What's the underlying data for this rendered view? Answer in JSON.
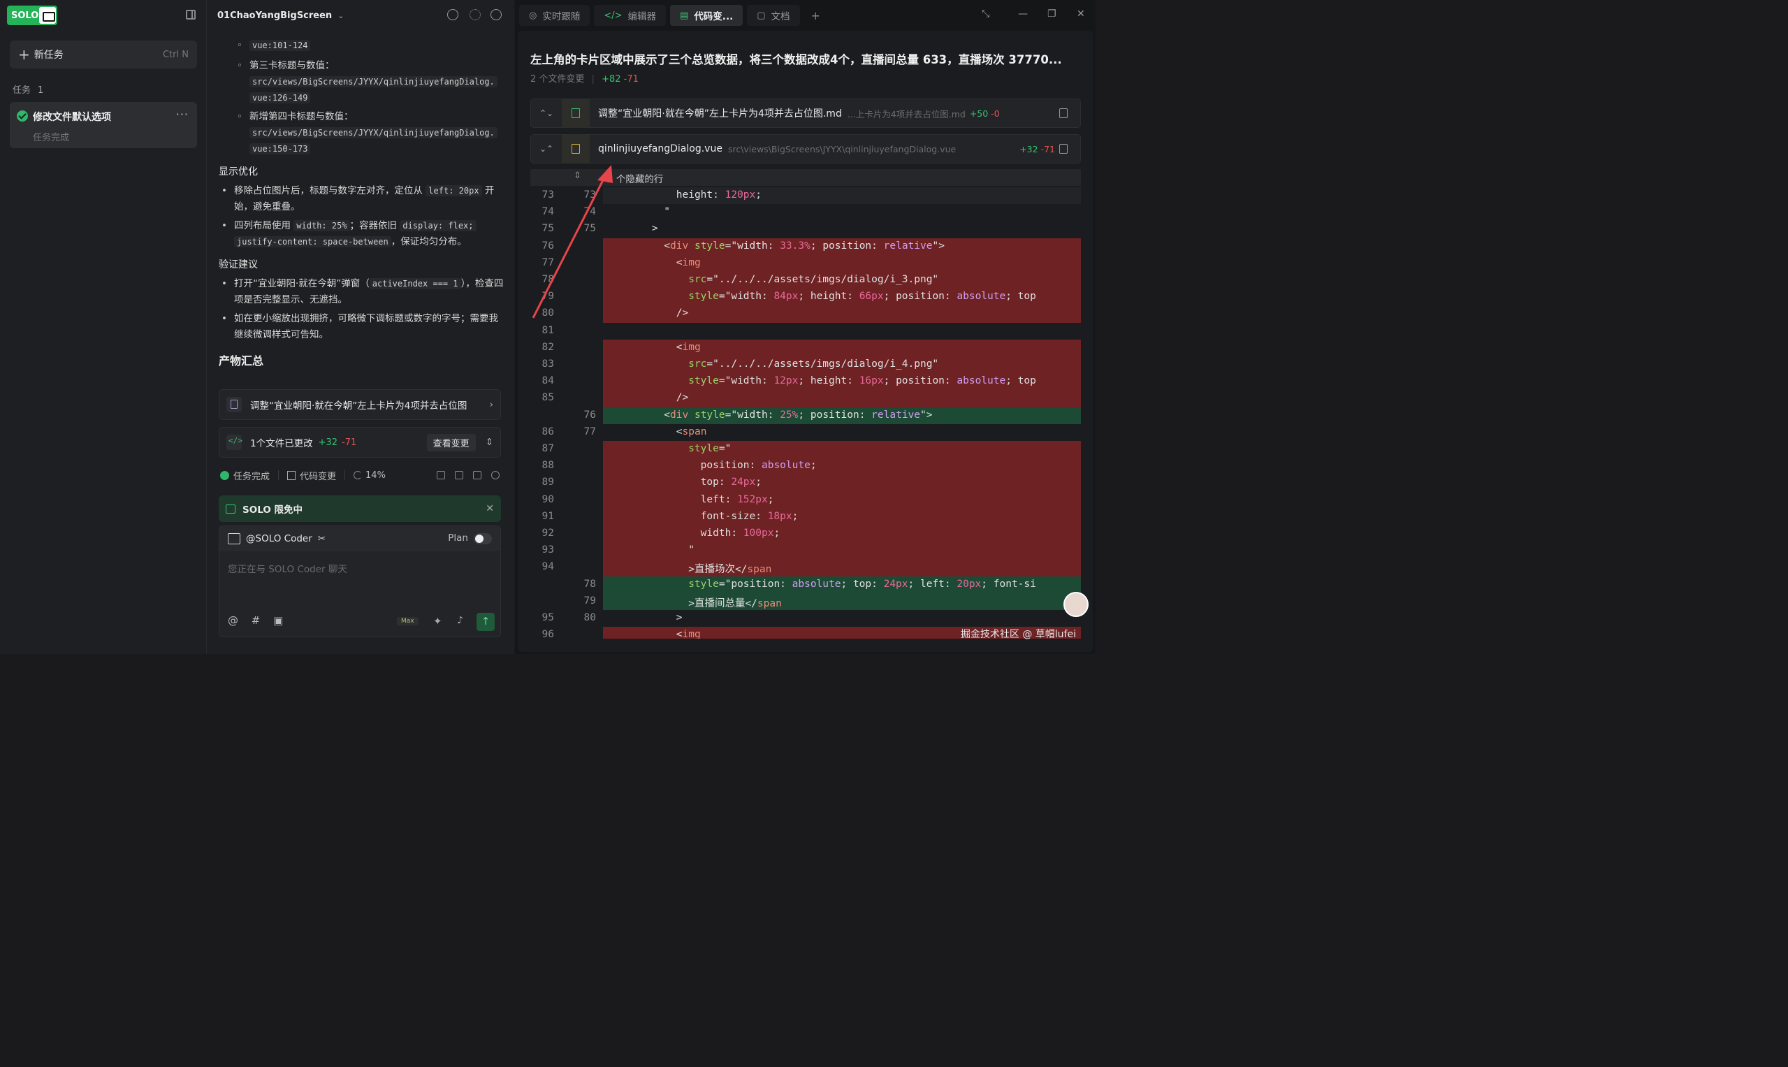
{
  "sidebar": {
    "logo_text": "SOLO",
    "new_task_label": "新任务",
    "new_task_shortcut": "Ctrl N",
    "tasks_header": "任务",
    "tasks_count": "1",
    "task": {
      "title": "修改文件默认选项",
      "status": "任务完成",
      "more": "···"
    }
  },
  "chat": {
    "project": "01ChaoYangBigScreen",
    "lines": {
      "l0": "vue:101-124",
      "l1_label": "第三卡标题与数值：",
      "l1_path": "src/views/BigScreens/JYYX/qinlinjiuyefangDialog.",
      "l1_range": "vue:126-149",
      "l2_label": "新增第四卡标题与数值：",
      "l2_path": "src/views/BigScreens/JYYX/qinlinjiuyefangDialog.",
      "l2_range": "vue:150-173"
    },
    "display_header": "显示优化",
    "d1_a": "移除占位图片后，标题与数字左对齐，定位从",
    "d1_code": "left: 20px",
    "d1_b": "开始，避免重叠。",
    "d2_a": "四列布局使用",
    "d2_code1": "width: 25%",
    "d2_b": "；容器依旧",
    "d2_code2": "display: flex;",
    "d2_code3": "justify-content: space-between",
    "d2_c": "，保证均匀分布。",
    "verify_header": "验证建议",
    "v1_a": "打开“宜业朝阳·就在今朝”弹窗（",
    "v1_code": "activeIndex === 1",
    "v1_b": "），检查四项是否完整显示、无遮挡。",
    "v2": "如在更小缩放出现拥挤，可略微下调标题或数字的字号；需要我继续微调样式可告知。",
    "artifacts_header": "产物汇总",
    "artifact_doc": "调整“宜业朝阳·就在今朝”左上卡片为4项并去占位图",
    "files_changed": "1个文件已更改",
    "files_add": "+32",
    "files_del": "-71",
    "view_changes": "查看变更",
    "status_done": "任务完成",
    "status_code": "代码变更",
    "status_pct": "14%",
    "promo": "SOLO 限免中",
    "agent": "@SOLO Coder",
    "plan_label": "Plan",
    "placeholder": "您正在与 SOLO Coder 聊天",
    "max_badge": "Max"
  },
  "tabs": [
    {
      "label": "实时跟随",
      "icon": "◎"
    },
    {
      "label": "编辑器",
      "icon": "</>"
    },
    {
      "label": "代码变...",
      "icon": "▤"
    },
    {
      "label": "文档",
      "icon": "▢"
    }
  ],
  "diffpane": {
    "title": "左上角的卡片区域中展示了三个总览数据，将三个数据改成4个，直播间总量 633，直播场次 37770...",
    "meta_files": "2 个文件变更",
    "meta_add": "+82",
    "meta_del": "-71",
    "file1": {
      "name": "调整“宜业朝阳·就在今朝”左上卡片为4项并去占位图.md",
      "path": "...上卡片为4项并去占位图.md",
      "add": "+50",
      "del": "-0"
    },
    "file2": {
      "name": "qinlinjiuyefangDialog.vue",
      "path": "src\\views\\BigScreens\\JYYX\\qinlinjiuyefangDialog.vue",
      "add": "+32",
      "del": "-71"
    },
    "hidden_rows": "2 个隐藏的行"
  },
  "diff_lines": [
    {
      "o": "73",
      "n": "73",
      "t": "ctx",
      "c": "            height: 120px;"
    },
    {
      "o": "74",
      "n": "74",
      "t": "ctx",
      "c": "          \""
    },
    {
      "o": "75",
      "n": "75",
      "t": "ctx",
      "c": "        >"
    },
    {
      "o": "76",
      "n": "",
      "t": "del",
      "c": "          <div style=\"width: 33.3%; position: relative\">"
    },
    {
      "o": "77",
      "n": "",
      "t": "del",
      "c": "            <img"
    },
    {
      "o": "78",
      "n": "",
      "t": "del",
      "c": "              src=\"../../../assets/imgs/dialog/i_3.png\""
    },
    {
      "o": "79",
      "n": "",
      "t": "del",
      "c": "              style=\"width: 84px; height: 66px; position: absolute; top"
    },
    {
      "o": "80",
      "n": "",
      "t": "del",
      "c": "            />"
    },
    {
      "o": "81",
      "n": "",
      "t": "ctx",
      "c": ""
    },
    {
      "o": "82",
      "n": "",
      "t": "del",
      "c": "            <img"
    },
    {
      "o": "83",
      "n": "",
      "t": "del",
      "c": "              src=\"../../../assets/imgs/dialog/i_4.png\""
    },
    {
      "o": "84",
      "n": "",
      "t": "del",
      "c": "              style=\"width: 12px; height: 16px; position: absolute; top"
    },
    {
      "o": "85",
      "n": "",
      "t": "del",
      "c": "            />"
    },
    {
      "o": "",
      "n": "76",
      "t": "add",
      "c": "          <div style=\"width: 25%; position: relative\">"
    },
    {
      "o": "86",
      "n": "77",
      "t": "ctx",
      "c": "            <span"
    },
    {
      "o": "87",
      "n": "",
      "t": "del",
      "c": "              style=\""
    },
    {
      "o": "88",
      "n": "",
      "t": "del",
      "c": "                position: absolute;"
    },
    {
      "o": "89",
      "n": "",
      "t": "del",
      "c": "                top: 24px;"
    },
    {
      "o": "90",
      "n": "",
      "t": "del",
      "c": "                left: 152px;"
    },
    {
      "o": "91",
      "n": "",
      "t": "del",
      "c": "                font-size: 18px;"
    },
    {
      "o": "92",
      "n": "",
      "t": "del",
      "c": "                width: 100px;"
    },
    {
      "o": "93",
      "n": "",
      "t": "del",
      "c": "              \""
    },
    {
      "o": "94",
      "n": "",
      "t": "del",
      "c": "              >直播场次</span"
    },
    {
      "o": "",
      "n": "78",
      "t": "add",
      "c": "              style=\"position: absolute; top: 24px; left: 20px; font-si"
    },
    {
      "o": "",
      "n": "79",
      "t": "add",
      "c": "              >直播间总量</span"
    },
    {
      "o": "95",
      "n": "80",
      "t": "ctx",
      "c": "            >"
    },
    {
      "o": "96",
      "n": "",
      "t": "del",
      "c": "            <img"
    }
  ],
  "watermark": "掘金技术社区 @ 草帽lufei",
  "colors": {
    "accent_green": "#25b35a",
    "diff_del": "#6e2224",
    "diff_add": "#1c4a35",
    "arrow": "#e8444a"
  }
}
